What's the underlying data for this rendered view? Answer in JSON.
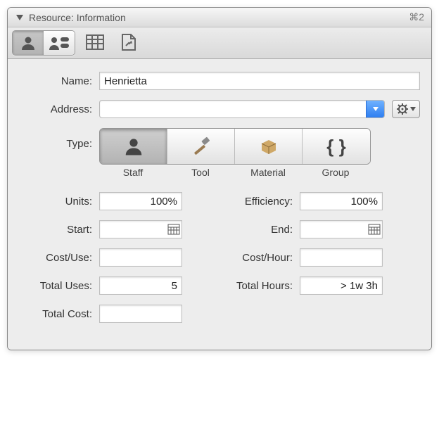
{
  "header": {
    "title": "Resource: Information",
    "shortcut": "⌘2"
  },
  "fields": {
    "name": {
      "label": "Name:",
      "value": "Henrietta"
    },
    "address": {
      "label": "Address:",
      "value": ""
    },
    "type": {
      "label": "Type:",
      "options": [
        "Staff",
        "Tool",
        "Material",
        "Group"
      ],
      "selected": 0
    },
    "units": {
      "label": "Units:",
      "value": "100%"
    },
    "efficiency": {
      "label": "Efficiency:",
      "value": "100%"
    },
    "start": {
      "label": "Start:",
      "value": ""
    },
    "end": {
      "label": "End:",
      "value": ""
    },
    "costUse": {
      "label": "Cost/Use:",
      "value": ""
    },
    "costHour": {
      "label": "Cost/Hour:",
      "value": ""
    },
    "totalUses": {
      "label": "Total Uses:",
      "value": "5"
    },
    "totalHours": {
      "label": "Total Hours:",
      "value": "> 1w 3h"
    },
    "totalCost": {
      "label": "Total Cost:",
      "value": ""
    }
  }
}
